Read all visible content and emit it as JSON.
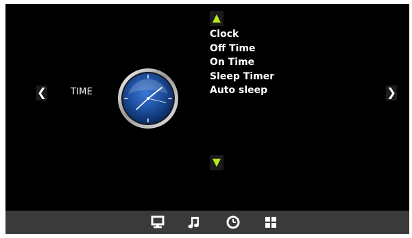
{
  "screen": {
    "background": "#000000",
    "accent": "#b6ea1e"
  },
  "nav": {
    "left_glyph": "❮",
    "right_glyph": "❯"
  },
  "section_label": "TIME",
  "menu": {
    "items": [
      "Clock",
      "Off Time",
      "On Time",
      "Sleep Timer",
      "Auto sleep"
    ]
  },
  "bottom_bar": {
    "icons": [
      "monitor-icon",
      "music-note-icon",
      "clock-icon",
      "apps-grid-icon"
    ],
    "selected": "clock-icon"
  }
}
